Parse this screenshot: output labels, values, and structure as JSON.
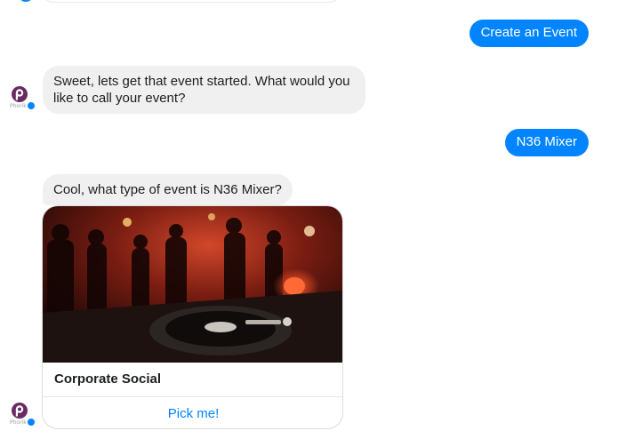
{
  "messages": {
    "user_1": "Create an Event",
    "bot_1": "Sweet, lets get that event started. What would you like to call your event?",
    "user_2": "N36 Mixer",
    "bot_2": "Cool, what type of event is N36 Mixer?"
  },
  "card": {
    "title": "Corporate Social",
    "button_label": "Pick me!"
  },
  "bot": {
    "brand_text": "Phorik"
  },
  "colors": {
    "outgoing_bubble": "#0084ff",
    "incoming_bubble": "#f0f0f0",
    "link": "#0084ff",
    "avatar_logo": "#6b2a63"
  }
}
